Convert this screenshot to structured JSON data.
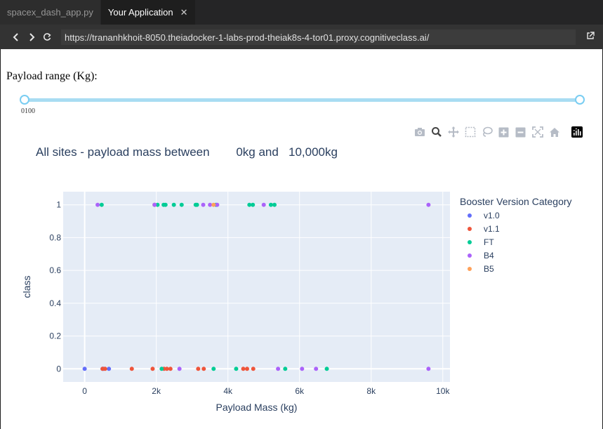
{
  "tabs": [
    {
      "label": "spacex_dash_app.py",
      "active": false
    },
    {
      "label": "Your Application",
      "active": true
    }
  ],
  "browser": {
    "url": "https://trananhkhoit-8050.theiadocker-1-labs-prod-theiak8s-4-tor01.proxy.cognitiveclass.ai/",
    "back_icon": "chevron-left-icon",
    "forward_icon": "chevron-right-icon",
    "reload_icon": "reload-icon",
    "open_external_icon": "open-external-icon"
  },
  "page": {
    "payload_label": "Payload range (Kg):",
    "slider": {
      "min": 0,
      "max": 10000,
      "low": 0,
      "high": 10000,
      "mark_label": "0100"
    },
    "modebar": [
      "camera-icon",
      "zoom-icon",
      "pan-icon",
      "box-select-icon",
      "lasso-icon",
      "zoom-in-icon",
      "zoom-out-icon",
      "autoscale-icon",
      "reset-axes-icon",
      "plotly-logo-icon"
    ],
    "chart_title": "All sites - payload mass between        0kg and   10,000kg"
  },
  "colors": {
    "v1.0": "#636efa",
    "v1.1": "#ef553b",
    "FT": "#00cc96",
    "B4": "#ab63fa",
    "B5": "#ffa15a",
    "plot_bg": "#e5ecf6",
    "axis_text": "#2a3f5f"
  },
  "chart_data": {
    "type": "scatter",
    "xlabel": "Payload Mass (kg)",
    "ylabel": "class",
    "xlim": [
      -600,
      10200
    ],
    "ylim": [
      -0.08,
      1.08
    ],
    "x_ticks": [
      0,
      2000,
      4000,
      6000,
      8000,
      10000
    ],
    "x_tick_labels": [
      "0",
      "2k",
      "4k",
      "6k",
      "8k",
      "10k"
    ],
    "y_ticks": [
      0,
      0.2,
      0.4,
      0.6,
      0.8,
      1
    ],
    "y_tick_labels": [
      "0",
      "0.2",
      "0.4",
      "0.6",
      "0.8",
      "1"
    ],
    "grid": true,
    "legend_title": "Booster Version Category",
    "legend_position": "right",
    "series": [
      {
        "name": "v1.0",
        "points": [
          [
            0,
            0
          ],
          [
            525,
            0
          ],
          [
            677,
            0
          ],
          [
            500,
            0
          ]
        ]
      },
      {
        "name": "v1.1",
        "points": [
          [
            500,
            0
          ],
          [
            570,
            0
          ],
          [
            1316,
            0
          ],
          [
            1898,
            0
          ],
          [
            1952,
            1
          ],
          [
            2216,
            0
          ],
          [
            2296,
            0
          ],
          [
            2395,
            0
          ],
          [
            3170,
            0
          ],
          [
            3325,
            0
          ],
          [
            4428,
            0
          ],
          [
            4535,
            0
          ],
          [
            4707,
            0
          ]
        ]
      },
      {
        "name": "FT",
        "points": [
          [
            475,
            1
          ],
          [
            2034,
            1
          ],
          [
            2150,
            0
          ],
          [
            2205,
            1
          ],
          [
            2257,
            1
          ],
          [
            2490,
            1
          ],
          [
            2708,
            1
          ],
          [
            3100,
            1
          ],
          [
            3136,
            1
          ],
          [
            3600,
            0
          ],
          [
            3669,
            1
          ],
          [
            4600,
            1
          ],
          [
            4696,
            1
          ],
          [
            5200,
            1
          ],
          [
            5300,
            1
          ],
          [
            5600,
            0
          ],
          [
            6761,
            0
          ],
          [
            4230,
            0
          ]
        ]
      },
      {
        "name": "B4",
        "points": [
          [
            362,
            1
          ],
          [
            1952,
            1
          ],
          [
            2647,
            0
          ],
          [
            3310,
            1
          ],
          [
            3500,
            1
          ],
          [
            3700,
            1
          ],
          [
            5000,
            1
          ],
          [
            5400,
            0
          ],
          [
            6070,
            0
          ],
          [
            6460,
            0
          ],
          [
            9600,
            1
          ],
          [
            9600,
            0
          ]
        ]
      },
      {
        "name": "B5",
        "points": [
          [
            3600,
            1
          ]
        ]
      }
    ]
  }
}
